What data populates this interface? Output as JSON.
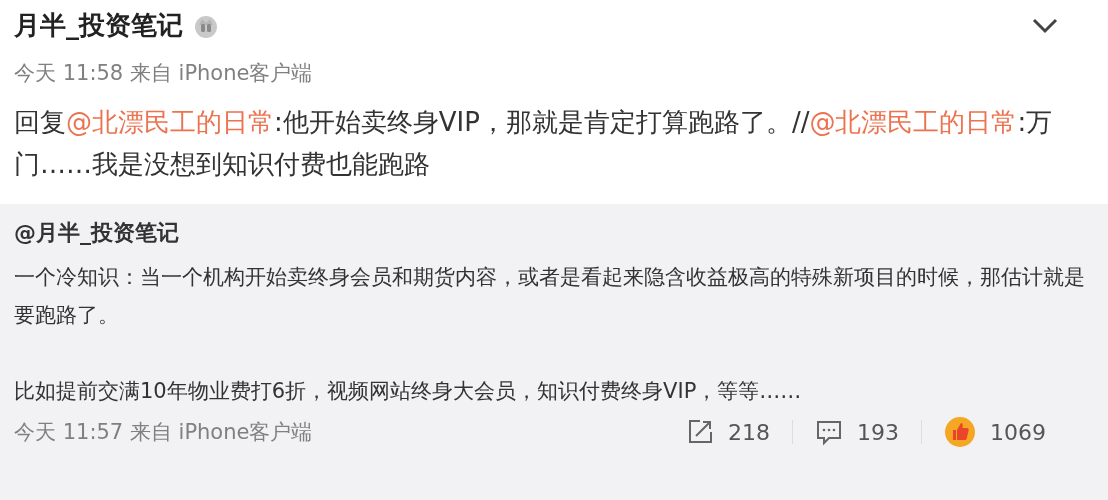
{
  "post": {
    "author": "月半_投资笔记",
    "meta": "今天 11:58 来自 iPhone客户端",
    "content": [
      {
        "kind": "text",
        "text": "回复"
      },
      {
        "kind": "mention",
        "text": "@北漂民工的日常"
      },
      {
        "kind": "text",
        "text": ":他开始卖终身VIP，那就是肯定打算跑路了。//"
      },
      {
        "kind": "mention",
        "text": "@北漂民工的日常"
      },
      {
        "kind": "text",
        "text": ":万门……我是没想到知识付费也能跑路"
      }
    ]
  },
  "repost": {
    "author": "@月半_投资笔记",
    "paragraphs": [
      "一个冷知识：当一个机构开始卖终身会员和期货内容，或者是看起来隐含收益极高的特殊新项目的时候，那估计就是要跑路了。",
      "比如提前交满10年物业费打6折，视频网站终身大会员，知识付费终身VIP，等等……"
    ],
    "meta": "今天 11:57 来自 iPhone客户端",
    "actions": [
      {
        "kind": "share",
        "count": "218"
      },
      {
        "kind": "comment",
        "count": "193"
      },
      {
        "kind": "like",
        "count": "1069"
      }
    ]
  }
}
